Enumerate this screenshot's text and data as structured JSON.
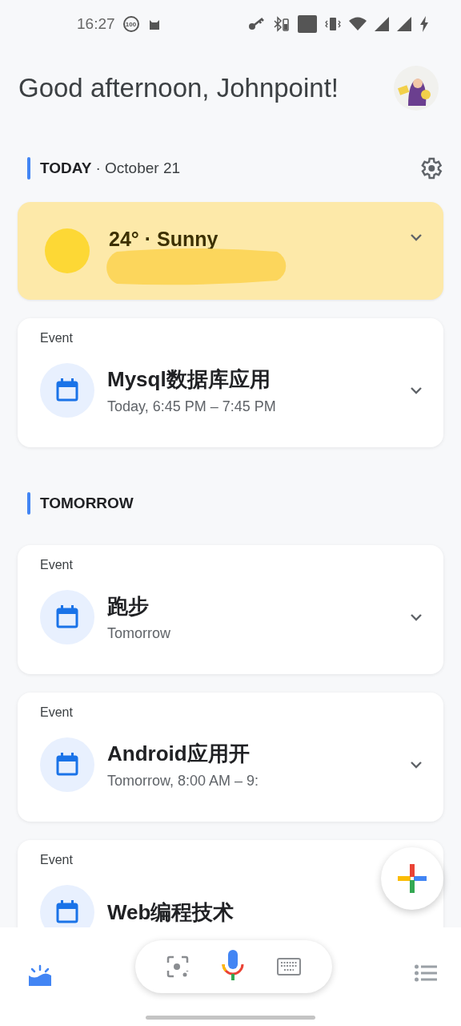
{
  "status_bar": {
    "time": "16:27",
    "badge": "100"
  },
  "greeting": "Good afternoon, Johnpoint!",
  "sections": [
    {
      "title": "TODAY",
      "subtitle": "· October 21",
      "settings": true,
      "cards": [
        {
          "kind": "weather",
          "title": "24° · Sunny",
          "redacted": true
        },
        {
          "kind": "event",
          "label": "Event",
          "title": "Mysql数据库应用",
          "time": "Today, 6:45 PM – 7:45 PM"
        }
      ]
    },
    {
      "title": "TOMORROW",
      "settings": false,
      "cards": [
        {
          "kind": "event",
          "label": "Event",
          "title": "跑步",
          "time": "Tomorrow"
        },
        {
          "kind": "event",
          "label": "Event",
          "title": "Android应用开",
          "time": "Tomorrow, 8:00 AM – 9:"
        },
        {
          "kind": "event",
          "label": "Event",
          "title": "Web编程技术"
        }
      ]
    }
  ],
  "bottom_nav": [
    {
      "kind": "today",
      "selected": true
    },
    {
      "kind": "search",
      "selected": false
    },
    {
      "kind": "list",
      "selected": false
    }
  ]
}
